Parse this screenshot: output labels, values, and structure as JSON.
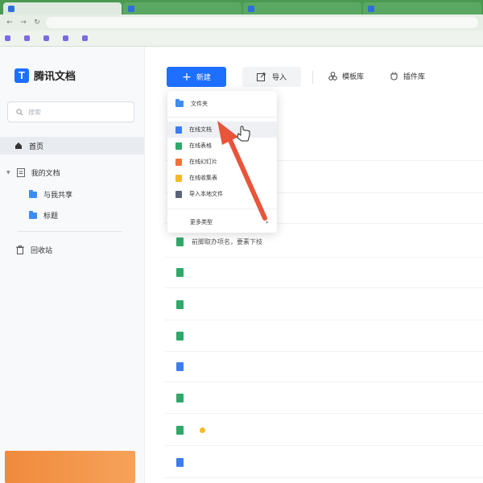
{
  "colors": {
    "accent": "#1e6fff",
    "browser_frame": "#4a9a52",
    "annotation_arrow": "#e8553a"
  },
  "sidebar": {
    "logo_text": "腾讯文档",
    "search_placeholder": "搜索",
    "home_label": "首页",
    "my_docs_label": "我的文档",
    "shared_label": "与我共享",
    "tags_label": "标题",
    "recycle_label": "回收站"
  },
  "toolbar": {
    "new_label": "新建",
    "import_label": "导入",
    "template_label": "模板库",
    "plugin_label": "插件库"
  },
  "new_menu": {
    "folder": "文件夹",
    "online_doc": "在线文档",
    "online_sheet": "在线表格",
    "online_slides": "在线幻灯片",
    "online_form": "在线收集表",
    "import_local": "导入本地文件",
    "more_types": "更多类型"
  },
  "documents": [
    {
      "name": "",
      "icon": "green-doc-icon"
    },
    {
      "name": "",
      "icon": "green-doc-icon"
    },
    {
      "name": "",
      "icon": "green-doc-icon"
    },
    {
      "name": "",
      "icon": "green-doc-icon"
    },
    {
      "name": "",
      "icon": "blue-doc-icon"
    },
    {
      "name": "",
      "icon": "green-doc-icon"
    },
    {
      "name": "",
      "icon": "green-doc-icon",
      "starred": true
    },
    {
      "name": "",
      "icon": "blue-doc-icon"
    }
  ],
  "visible_doc_text": "前脚取办项名，要素下枝"
}
